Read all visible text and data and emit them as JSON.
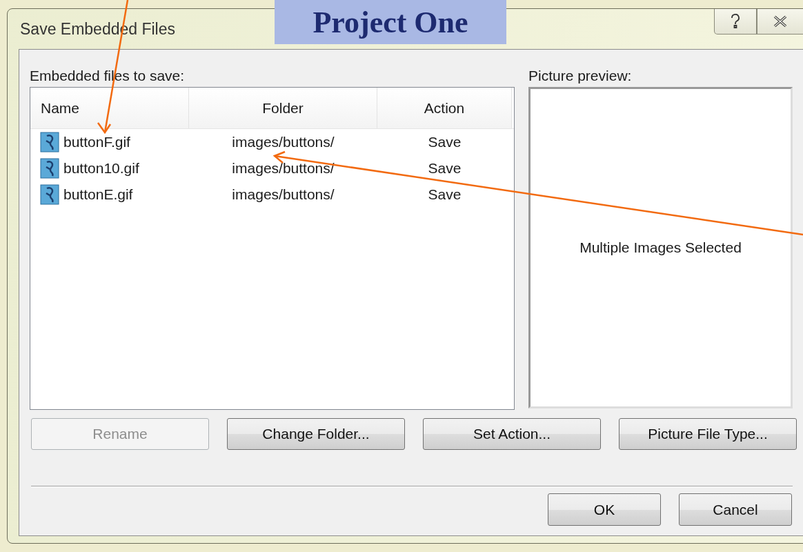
{
  "background_banner": {
    "text": "Project One"
  },
  "window": {
    "title": "Save Embedded Files"
  },
  "files": {
    "label": "Embedded files to save:",
    "columns": [
      "Name",
      "Folder",
      "Action"
    ],
    "rows": [
      {
        "name": "buttonF.gif",
        "folder": "images/buttons/",
        "action": "Save"
      },
      {
        "name": "button10.gif",
        "folder": "images/buttons/",
        "action": "Save"
      },
      {
        "name": "buttonE.gif",
        "folder": "images/buttons/",
        "action": "Save"
      }
    ]
  },
  "preview": {
    "label": "Picture preview:",
    "message": "Multiple Images Selected"
  },
  "action_buttons": [
    {
      "label": "Rename",
      "disabled": true
    },
    {
      "label": "Change Folder...",
      "disabled": false
    },
    {
      "label": "Set Action...",
      "disabled": false
    },
    {
      "label": "Picture File Type...",
      "disabled": false
    }
  ],
  "dialog_buttons": [
    {
      "label": "OK"
    },
    {
      "label": "Cancel"
    }
  ]
}
